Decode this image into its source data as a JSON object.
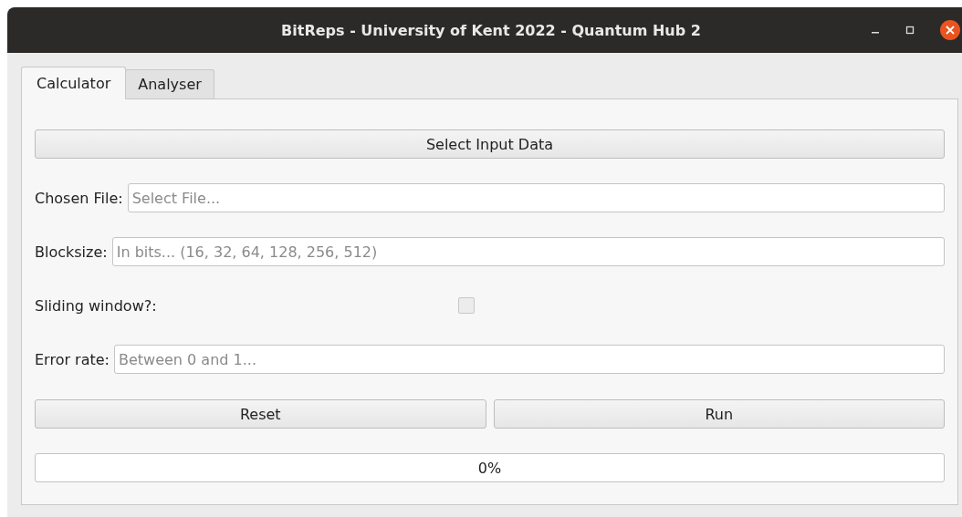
{
  "window": {
    "title": "BitReps - University of Kent 2022 - Quantum Hub 2"
  },
  "tabs": [
    {
      "label": "Calculator",
      "selected": true
    },
    {
      "label": "Analyser",
      "selected": false
    }
  ],
  "select_button": "Select Input Data",
  "rows": [
    {
      "kind": "field",
      "label": "Chosen File:",
      "placeholder": "Select File..."
    },
    {
      "kind": "field",
      "label": "Blocksize:",
      "placeholder": "In bits... (16, 32, 64, 128, 256, 512)"
    },
    {
      "kind": "checkbox",
      "label": "Sliding window?:",
      "checked": false
    },
    {
      "kind": "field",
      "label": "Error rate:",
      "placeholder": "Between 0 and 1..."
    }
  ],
  "buttons": [
    "Reset",
    "Run"
  ],
  "progress": {
    "level": 0,
    "reading": "0%"
  }
}
